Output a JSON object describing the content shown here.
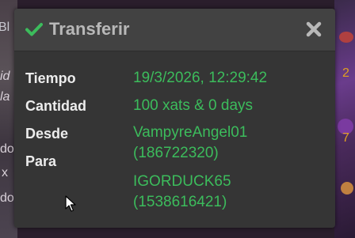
{
  "background": {
    "left_fragments": [
      "Bl",
      "id",
      "la",
      "do",
      "x",
      "do"
    ],
    "right_fragments": [
      "2",
      "7"
    ]
  },
  "dialog": {
    "title": "Transferir",
    "title_icon": "check-icon",
    "close_icon": "close-icon",
    "accent_color": "#3cbc5c",
    "rows": [
      {
        "label": "Tiempo",
        "value": "19/3/2026, 12:29:42"
      },
      {
        "label": "Cantidad",
        "value": "100 xats & 0 days"
      },
      {
        "label": "Desde",
        "value_lines": [
          "VampyreAngel01",
          "(186722320)"
        ]
      },
      {
        "label": "Para",
        "value_lines": [
          "IGORDUCK65",
          "(1538616421)"
        ]
      }
    ]
  }
}
